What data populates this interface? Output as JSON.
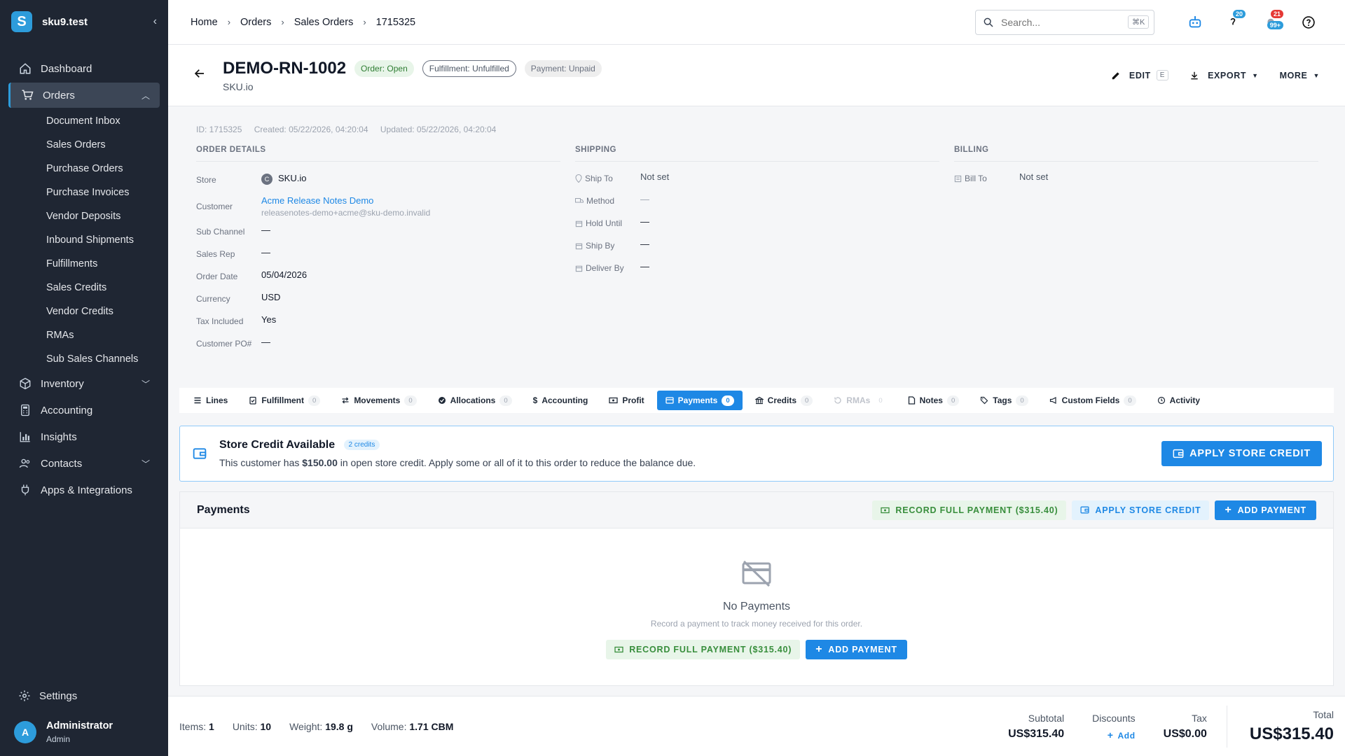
{
  "app": {
    "name": "sku9.test",
    "logo_letter": "S"
  },
  "sidebar": {
    "items": [
      {
        "label": "Dashboard",
        "icon": "home-icon"
      },
      {
        "label": "Orders",
        "icon": "cart-icon"
      },
      {
        "label": "Inventory",
        "icon": "box-icon"
      },
      {
        "label": "Accounting",
        "icon": "calculator-icon"
      },
      {
        "label": "Insights",
        "icon": "bar-chart-icon"
      },
      {
        "label": "Contacts",
        "icon": "contacts-icon"
      },
      {
        "label": "Apps & Integrations",
        "icon": "plug-icon"
      }
    ],
    "orders_sub": [
      "Document Inbox",
      "Sales Orders",
      "Purchase Orders",
      "Purchase Invoices",
      "Vendor Deposits",
      "Inbound Shipments",
      "Fulfillments",
      "Sales Credits",
      "Vendor Credits",
      "RMAs",
      "Sub Sales Channels"
    ],
    "settings": "Settings",
    "user": {
      "initial": "A",
      "name": "Administrator",
      "role": "Admin"
    }
  },
  "topbar": {
    "breadcrumbs": [
      "Home",
      "Orders",
      "Sales Orders",
      "1715325"
    ],
    "search_placeholder": "Search...",
    "search_kbd": "⌘K",
    "badge_help": "20",
    "badge_notif_top": "21",
    "badge_notif_bottom": "99+"
  },
  "order": {
    "title": "DEMO-RN-1002",
    "store": "SKU.io",
    "chips": {
      "order": "Order: Open",
      "fulfillment": "Fulfillment: Unfulfilled",
      "payment": "Payment: Unpaid"
    },
    "actions": {
      "edit": "EDIT",
      "edit_kbd": "E",
      "export": "EXPORT",
      "more": "MORE"
    },
    "meta": {
      "id": "ID: 1715325",
      "created": "Created: 05/22/2026, 04:20:04",
      "updated": "Updated: 05/22/2026, 04:20:04"
    }
  },
  "details": {
    "order_title": "ORDER DETAILS",
    "store_label": "Store",
    "store_initial": "C",
    "store_value": "SKU.io",
    "customer_label": "Customer",
    "customer_name": "Acme Release Notes Demo",
    "customer_email": "releasenotes-demo+acme@sku-demo.invalid",
    "sub_channel_label": "Sub Channel",
    "sub_channel_value": "—",
    "sales_rep_label": "Sales Rep",
    "sales_rep_value": "—",
    "order_date_label": "Order Date",
    "order_date_value": "05/04/2026",
    "currency_label": "Currency",
    "currency_value": "USD",
    "tax_label": "Tax Included",
    "tax_value": "Yes",
    "po_label": "Customer PO#",
    "po_value": "—",
    "shipping_title": "SHIPPING",
    "ship_to_label": "Ship To",
    "ship_to_value": "Not set",
    "method_label": "Method",
    "method_value": "—",
    "hold_label": "Hold Until",
    "hold_value": "—",
    "ship_by_label": "Ship By",
    "ship_by_value": "—",
    "deliver_by_label": "Deliver By",
    "deliver_by_value": "—",
    "billing_title": "BILLING",
    "bill_to_label": "Bill To",
    "bill_to_value": "Not set"
  },
  "tabs": [
    {
      "label": "Lines",
      "count": null
    },
    {
      "label": "Fulfillment",
      "count": "0"
    },
    {
      "label": "Movements",
      "count": "0"
    },
    {
      "label": "Allocations",
      "count": "0"
    },
    {
      "label": "Accounting",
      "count": null
    },
    {
      "label": "Profit",
      "count": null
    },
    {
      "label": "Payments",
      "count": "0"
    },
    {
      "label": "Credits",
      "count": "0"
    },
    {
      "label": "RMAs",
      "count": "0"
    },
    {
      "label": "Notes",
      "count": "0"
    },
    {
      "label": "Tags",
      "count": "0"
    },
    {
      "label": "Custom Fields",
      "count": "0"
    },
    {
      "label": "Activity",
      "count": null
    }
  ],
  "credit": {
    "title": "Store Credit Available",
    "chip": "2 credits",
    "desc_prefix": "This customer has ",
    "amount": "$150.00",
    "desc_suffix": " in open store credit. Apply some or all of it to this order to reduce the balance due.",
    "button": "APPLY STORE CREDIT"
  },
  "payments": {
    "title": "Payments",
    "record_full": "RECORD FULL PAYMENT ($315.40)",
    "apply_credit": "APPLY STORE CREDIT",
    "add_payment": "ADD PAYMENT",
    "empty_title": "No Payments",
    "empty_sub": "Record a payment to track money received for this order."
  },
  "footer": {
    "items_label": "Items:",
    "items_value": "1",
    "units_label": "Units:",
    "units_value": "10",
    "weight_label": "Weight:",
    "weight_value": "19.8 g",
    "volume_label": "Volume:",
    "volume_value": "1.71 CBM",
    "subtotal_label": "Subtotal",
    "subtotal_value": "US$315.40",
    "discounts_label": "Discounts",
    "discounts_add": "Add",
    "tax_label": "Tax",
    "tax_value": "US$0.00",
    "total_label": "Total",
    "total_value": "US$315.40"
  },
  "colors": {
    "sidebar_bg": "#1f2633",
    "accent": "#1e88e5",
    "success_bg": "#e8f5e9",
    "success_text": "#388e3c"
  }
}
